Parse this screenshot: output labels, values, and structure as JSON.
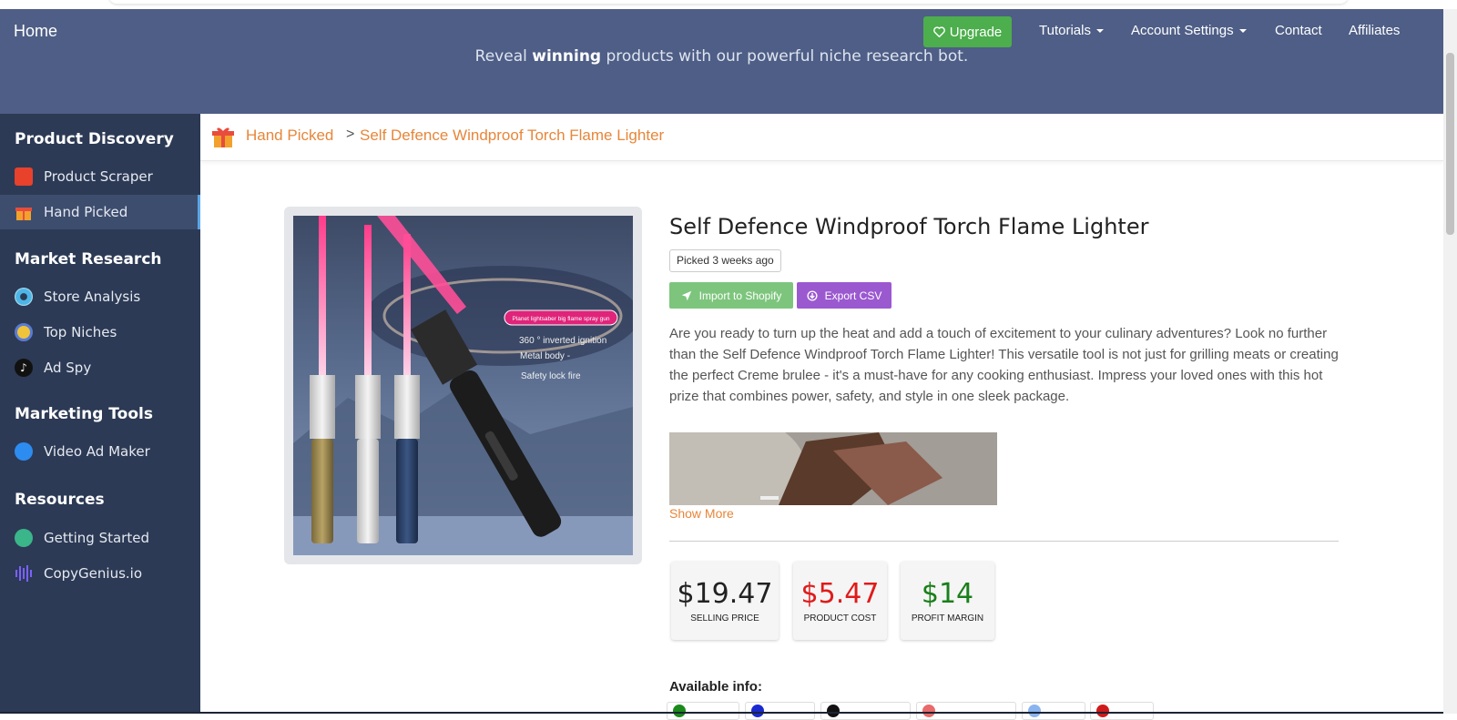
{
  "header": {
    "home": "Home",
    "subtitle_pre": "Reveal ",
    "subtitle_bold": "winning",
    "subtitle_post": " products with our powerful niche research bot.",
    "upgrade": "Upgrade",
    "nav": [
      "Tutorials",
      "Account Settings",
      "Contact",
      "Affiliates"
    ]
  },
  "sidebar": {
    "sections": [
      {
        "heading": "Product Discovery",
        "items": [
          "Product Scraper",
          "Hand Picked"
        ]
      },
      {
        "heading": "Market Research",
        "items": [
          "Store Analysis",
          "Top Niches",
          "Ad Spy"
        ]
      },
      {
        "heading": "Marketing Tools",
        "items": [
          "Video Ad Maker"
        ]
      },
      {
        "heading": "Resources",
        "items": [
          "Getting Started",
          "CopyGenius.io"
        ]
      }
    ],
    "active": "Hand Picked"
  },
  "breadcrumb": {
    "parent": "Hand Picked",
    "separator": ">",
    "current": "Self Defence Windproof Torch Flame Lighter"
  },
  "product": {
    "title": "Self Defence Windproof Torch Flame Lighter",
    "picked": "Picked 3 weeks ago",
    "import_btn": "Import to Shopify",
    "export_btn": "Export CSV",
    "description": "Are you ready to turn up the heat and add a touch of excitement to your culinary adventures? Look no further than the Self Defence Windproof Torch Flame Lighter! This versatile tool is not just for grilling meats or creating the perfect Creme brulee - it's a must-have for any cooking enthusiast. Impress your loved ones with this hot prize that combines power, safety, and style in one sleek package.",
    "show_more": "Show More",
    "image_labels": {
      "tag": "Planet lightsaber big flame spray gun",
      "f1": "360 ° inverted ignition",
      "f2": "Metal body -",
      "f3": "Safety lock fire"
    }
  },
  "stats": [
    {
      "value": "$19.47",
      "label": "SELLING PRICE",
      "color": "#222222"
    },
    {
      "value": "$5.47",
      "label": "PRODUCT COST",
      "color": "#e01b1b"
    },
    {
      "value": "$14",
      "label": "PROFIT MARGIN",
      "color": "#1a7f1a"
    }
  ],
  "available_info": {
    "label": "Available info:"
  },
  "colors": {
    "header": "#4e5e86",
    "sidebar": "#2c3a55",
    "accent_orange": "#e7863a",
    "upgrade_green": "#4cae4c"
  }
}
